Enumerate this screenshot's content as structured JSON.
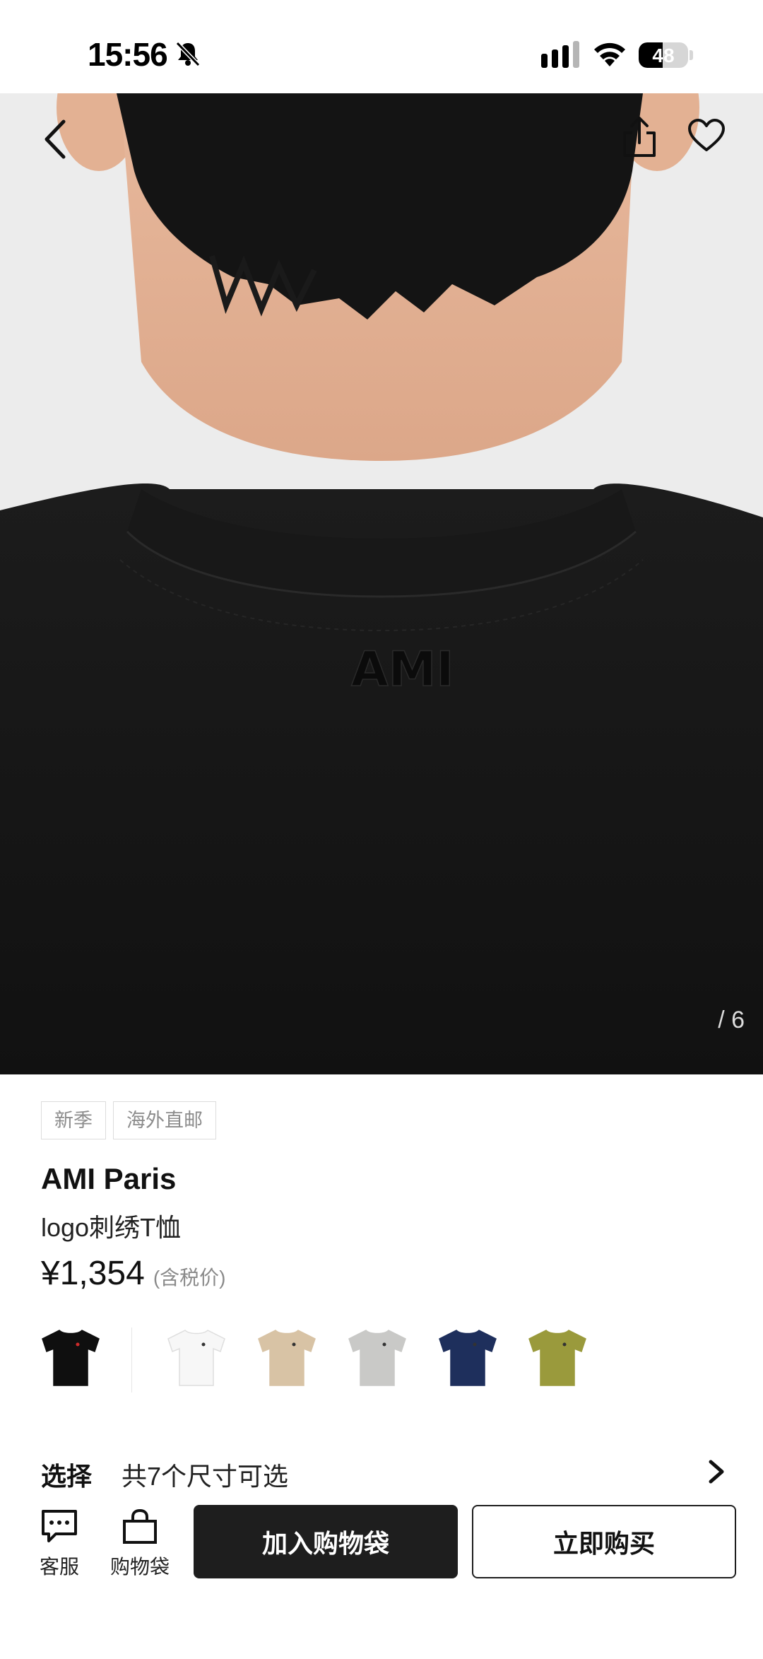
{
  "status_bar": {
    "time": "15:56",
    "battery": "48",
    "battery_level": 0.48
  },
  "gallery": {
    "counter": "/ 6",
    "embroidery_text": "AMI"
  },
  "product": {
    "tags": [
      "新季",
      "海外直邮"
    ],
    "brand": "AMI Paris",
    "name": "logo刺绣T恤",
    "price": "¥1,354",
    "price_note": "(含税价)"
  },
  "colors": [
    {
      "name": "black",
      "hex": "#0f0f0f",
      "selected": true
    },
    {
      "name": "white",
      "hex": "#f7f7f7"
    },
    {
      "name": "beige",
      "hex": "#d8c3a5"
    },
    {
      "name": "grey",
      "hex": "#c9c9c7"
    },
    {
      "name": "navy",
      "hex": "#1e2f5c"
    },
    {
      "name": "olive",
      "hex": "#9a9a3c"
    }
  ],
  "size_select": {
    "label": "选择",
    "value": "共7个尺寸可选"
  },
  "bottom_bar": {
    "service_label": "客服",
    "bag_label": "购物袋",
    "add_to_bag": "加入购物袋",
    "buy_now": "立即购买"
  }
}
